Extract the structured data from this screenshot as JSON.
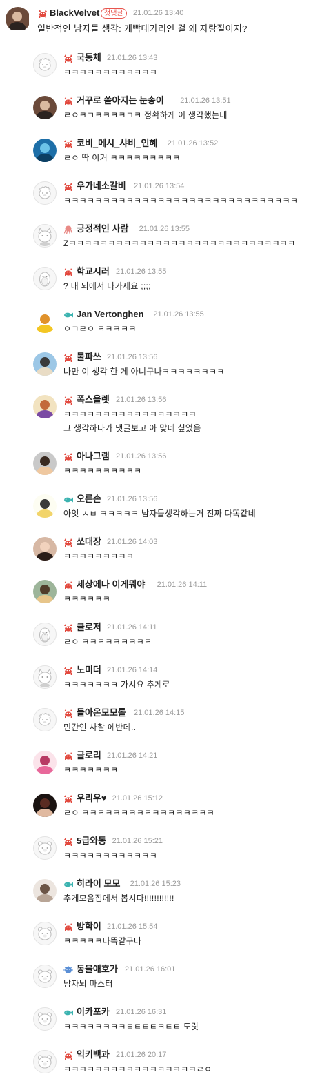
{
  "top_comment": {
    "nickname": "BlackVelvet",
    "op_badge": "첫댓글",
    "time": "21.01.26 13:40",
    "text": "일반적인 남자들 생각: 개빡대가리인 걸 왜 자랑질이지?",
    "badge": "crab",
    "avatar": "photo"
  },
  "replies": [
    {
      "nickname": "국동체",
      "time": "21.01.26 13:43",
      "lines": [
        "ㅋㅋㅋㅋㅋㅋㅋㅋㅋㅋㅋㅋ"
      ],
      "badge": "crab",
      "avatar": "default-sheep"
    },
    {
      "nickname": "거꾸로 쏟아지는 눈송이",
      "time": "21.01.26 13:51",
      "lines": [
        "ㄹㅇㅋㄱㅋㅋㅋㅋㄱㅋ 정확하게 이 생각했는데"
      ],
      "badge": "crab",
      "avatar": "photo"
    },
    {
      "nickname": "코비_메시_샤비_인혜",
      "time": "21.01.26 13:52",
      "lines": [
        "ㄹㅇ 딱 이거 ㅋㅋㅋㅋㅋㅋㅋㅋㅋ"
      ],
      "badge": "crab",
      "avatar": "photo-blue"
    },
    {
      "nickname": "우가네소갈비",
      "time": "21.01.26 13:54",
      "lines": [
        "ㅋㅋㅋㅋㅋㅋㅋㅋㅋㅋㅋㅋㅋㅋㅋㅋㅋㅋㅋㅋㅋㅋㅋㅋㅋㅋㅋㅋㅋㅋ"
      ],
      "badge": "crab",
      "avatar": "default-sheep"
    },
    {
      "nickname": "긍정적인 사람",
      "time": "21.01.26 13:55",
      "lines": [
        "Zㅋㅋㅋㅋㅋㅋㅋㅋㅋㅋㅋㅋㅋㅋㅋㅋㅋㅋㅋㅋㅋㅋㅋㅋㅋㅋㅋㅋㅋ"
      ],
      "badge": "octopus",
      "avatar": "default-cat"
    },
    {
      "nickname": "학교시러",
      "time": "21.01.26 13:55",
      "lines": [
        "? 내 뇌에서 나가세요 ;;;;"
      ],
      "badge": "crab",
      "avatar": "default-penguin"
    },
    {
      "nickname": "Jan Vertonghen",
      "time": "21.01.26 13:55",
      "lines": [
        "ㅇㄱㄹㅇ ㅋㅋㅋㅋㅋ"
      ],
      "badge": "fish",
      "avatar": "photo-yellow"
    },
    {
      "nickname": "물파쓰",
      "time": "21.01.26 13:56",
      "lines": [
        "나만 이 생각 한 게 아니구나ㅋㅋㅋㅋㅋㅋㅋㅋ"
      ],
      "badge": "crab",
      "avatar": "photo-beach"
    },
    {
      "nickname": "폭스올렛",
      "time": "21.01.26 13:56",
      "lines": [
        "ㅋㅋㅋㅋㅋㅋㅋㅋㅋㅋㅋㅋㅋㅋㅋㅋㅋ",
        "그 생각하다가 댓글보고 아 맞네 싶었음"
      ],
      "badge": "crab",
      "avatar": "photo-purple"
    },
    {
      "nickname": "아나그램",
      "time": "21.01.26 13:56",
      "lines": [
        "ㅋㅋㅋㅋㅋㅋㅋㅋㅋㅋ"
      ],
      "badge": "crab",
      "avatar": "photo-person"
    },
    {
      "nickname": "오른손",
      "time": "21.01.26 13:56",
      "lines": [
        "아잇 ㅅㅂ ㅋㅋㅋㅋㅋ 남자들생각하는거 진짜 다똑같네"
      ],
      "badge": "fish",
      "avatar": "photo-drawing"
    },
    {
      "nickname": "쏘대장",
      "time": "21.01.26 14:03",
      "lines": [
        "ㅋㅋㅋㅋㅋㅋㅋㅋㅋ"
      ],
      "badge": "crab",
      "avatar": "photo-girl"
    },
    {
      "nickname": "세상에나 이게뭐야",
      "time": "21.01.26 14:11",
      "lines": [
        "ㅋㅋㅋㅋㅋㅋ"
      ],
      "badge": "crab",
      "avatar": "photo-cartoon"
    },
    {
      "nickname": "클로저",
      "time": "21.01.26 14:11",
      "lines": [
        "ㄹㅇ ㅋㅋㅋㅋㅋㅋㅋㅋㅋ"
      ],
      "badge": "crab",
      "avatar": "default-penguin"
    },
    {
      "nickname": "노미더",
      "time": "21.01.26 14:14",
      "lines": [
        "ㅋㅋㅋㅋㅋㅋㅋ 가시요 추게로"
      ],
      "badge": "crab",
      "avatar": "default-cat"
    },
    {
      "nickname": "돌아온모모롤",
      "time": "21.01.26 14:15",
      "lines": [
        "민간인 사찰 에반데.."
      ],
      "badge": "crab",
      "avatar": "default-sheep"
    },
    {
      "nickname": "글로리",
      "time": "21.01.26 14:21",
      "lines": [
        "ㅋㅋㅋㅋㅋㅋㅋ"
      ],
      "badge": "crab",
      "avatar": "photo-pink"
    },
    {
      "nickname": "우리우♥",
      "time": "21.01.26 15:12",
      "lines": [
        "ㄹㅇ ㅋㅋㅋㅋㅋㅋㅋㅋㅋㅋㅋㅋㅋㅋㅋㅋㅋ"
      ],
      "badge": "crab",
      "avatar": "photo-woman"
    },
    {
      "nickname": "5급와동",
      "time": "21.01.26 15:21",
      "lines": [
        "ㅋㅋㅋㅋㅋㅋㅋㅋㅋㅋㅋㅋ"
      ],
      "badge": "crab",
      "avatar": "default-bear"
    },
    {
      "nickname": "히라이 모모",
      "time": "21.01.26 15:23",
      "lines": [
        "추게모음집에서 봅시다!!!!!!!!!!!!"
      ],
      "badge": "fish",
      "avatar": "photo-sketch"
    },
    {
      "nickname": "방학이",
      "time": "21.01.26 15:54",
      "lines": [
        "ㅋㅋㅋㅋㅋ다똑같구나"
      ],
      "badge": "crab",
      "avatar": "default-bear"
    },
    {
      "nickname": "동물애호가",
      "time": "21.01.26 16:01",
      "lines": [
        "남자뇌 마스터"
      ],
      "badge": "blowfish",
      "avatar": "default-bear"
    },
    {
      "nickname": "이카포카",
      "time": "21.01.26 16:31",
      "lines": [
        "ㅋㅋㅋㅋㅋㅋㅋㅋㅌㅌㅌㅌㅋㅌㅌ 도랏"
      ],
      "badge": "fish",
      "avatar": "default-bear"
    },
    {
      "nickname": "익키백과",
      "time": "21.01.26 20:17",
      "lines": [
        "ㅋㅋㅋㅋㅋㅋㅋㅋㅋㅋㅋㅋㅋㅋㅋㅋㅋㄹㅇ"
      ],
      "badge": "crab",
      "avatar": "default-bear"
    }
  ],
  "colors": {
    "crab": "#e2483d",
    "fish": "#3bb3b0",
    "octopus": "#e98a86",
    "blowfish": "#5a8fd6",
    "time": "#9a9a9a",
    "op_badge": "#e8554e"
  }
}
